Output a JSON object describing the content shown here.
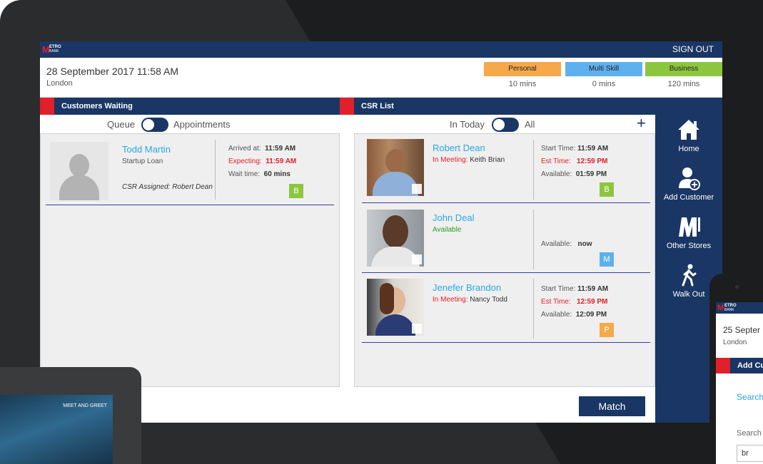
{
  "app": {
    "logo_letter": "M",
    "logo_word": "ETRO",
    "logo_sub": "BANK",
    "sign_out_label": "SIGN OUT"
  },
  "header": {
    "datetime": "28 September 2017 11:58 AM",
    "location": "London",
    "queues": [
      {
        "label": "Personal",
        "time": "10 mins",
        "color": "#f5a94b"
      },
      {
        "label": "Multi Skill",
        "time": "0 mins",
        "color": "#5fb0ee"
      },
      {
        "label": "Business",
        "time": "120 mins",
        "color": "#8cc63f"
      }
    ]
  },
  "customers_waiting": {
    "title": "Customers Waiting",
    "toggle_left": "Queue",
    "toggle_right": "Appointments",
    "items": [
      {
        "name": "Todd Martin",
        "purpose": "Startup Loan",
        "csr_assigned": "CSR Assigned: Robert Dean",
        "arrived_label": "Arrived at:",
        "arrived_value": "11:59 AM",
        "expecting_label": "Expecting:",
        "expecting_value": "11:59 AM",
        "wait_label": "Wait time:",
        "wait_value": "60 mins",
        "badge": "B"
      }
    ]
  },
  "csr_list": {
    "title": "CSR List",
    "toggle_left": "In Today",
    "toggle_right": "All",
    "add_icon": "plus-icon",
    "items": [
      {
        "name": "Robert Dean",
        "status_label": "In Meeting:",
        "status_value": "Keith Brian",
        "start_label": "Start Time:",
        "start_value": "11:59 AM",
        "est_label": "Est Time:",
        "est_value": "12:59 PM",
        "avail_label": "Available:",
        "avail_value": "01:59 PM",
        "badge": "B"
      },
      {
        "name": "John Deal",
        "status_value": "Available",
        "avail_label": "Available:",
        "avail_value": "now",
        "badge": "M"
      },
      {
        "name": "Jenefer Brandon",
        "status_label": "In Meeting:",
        "status_value": "Nancy Todd",
        "start_label": "Start Time:",
        "start_value": "11:59 AM",
        "est_label": "Est Time:",
        "est_value": "12:59 PM",
        "avail_label": "Available:",
        "avail_value": "12:09 PM",
        "badge": "P"
      }
    ]
  },
  "sidebar": {
    "items": [
      {
        "label": "Home",
        "icon": "home-icon"
      },
      {
        "label": "Add Customer",
        "icon": "add-user-icon"
      },
      {
        "label": "Other Stores",
        "icon": "metro-m-icon"
      },
      {
        "label": "Walk Out",
        "icon": "walking-person-icon"
      }
    ]
  },
  "match_button": "Match",
  "tablet": {
    "label": "MEET AND GREET"
  },
  "phone": {
    "datetime": "25 Septer",
    "location": "London",
    "section": "Add Cu",
    "search_tab": "Search",
    "search_label": "Search",
    "search_value": "br"
  }
}
